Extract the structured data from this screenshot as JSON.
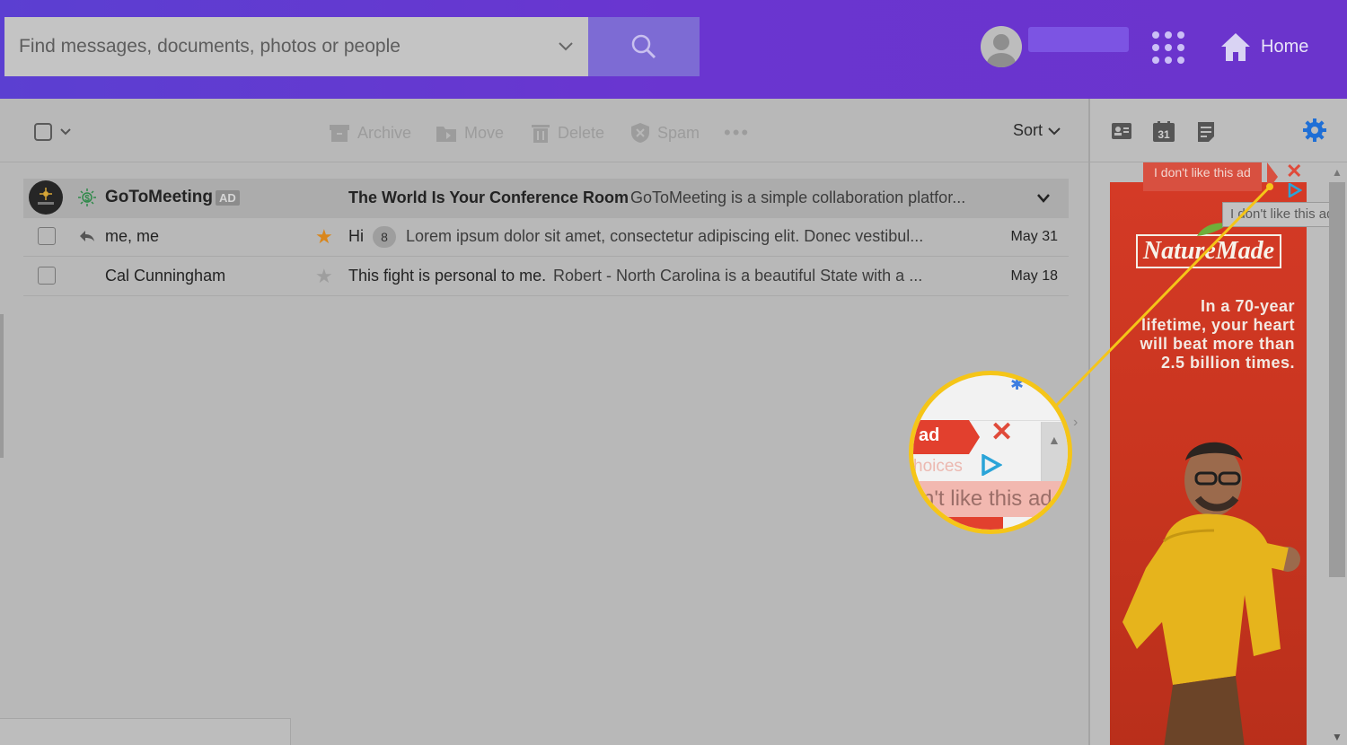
{
  "header": {
    "search_placeholder": "Find messages, documents, photos or people",
    "home_label": "Home"
  },
  "toolbar": {
    "archive": "Archive",
    "move": "Move",
    "delete": "Delete",
    "spam": "Spam",
    "more": "•••",
    "sort": "Sort"
  },
  "messages": [
    {
      "sender": "GoToMeeting",
      "badge": "AD",
      "subject": "The World Is Your Conference Room",
      "preview": "GoToMeeting is a simple collaboration platfor...",
      "is_ad": true
    },
    {
      "sender": "me, me",
      "starred": true,
      "subject": "Hi",
      "count": "8",
      "preview": "Lorem ipsum dolor sit amet, consectetur adipiscing elit. Donec vestibul...",
      "date": "May 31"
    },
    {
      "sender": "Cal Cunningham",
      "starred": false,
      "subject": "This fight is personal to me.",
      "preview": "Robert - North Carolina is a beautiful State with a ...",
      "date": "May 18"
    }
  ],
  "right_panel": {
    "calendar_day": "31"
  },
  "ad": {
    "tag": "I don't like this ad",
    "tooltip": "I don't like this ad",
    "brand": "NatureMade",
    "lines": [
      "In a 70-year",
      "lifetime, your heart",
      "will beat more than",
      "2.5 billion times."
    ]
  },
  "magnifier": {
    "ad_fragment": "ad",
    "choices_fragment": "hoices",
    "dont_fragment": "n't like this ad"
  },
  "colors": {
    "header_start": "#5b3fd1",
    "header_end": "#6b34cc",
    "ad_red": "#d43a26",
    "callout_yellow": "#f5c518",
    "gear_blue": "#1f6fd6",
    "star_orange": "#d9861c"
  }
}
